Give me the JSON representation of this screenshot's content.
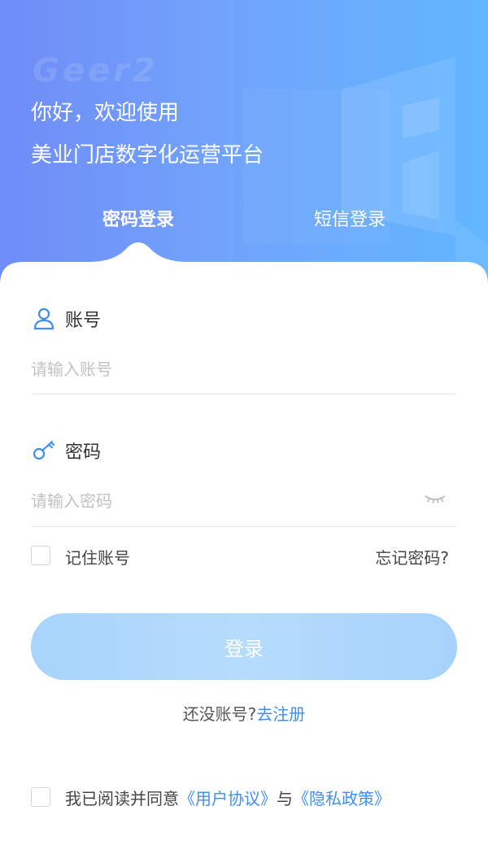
{
  "hero": {
    "watermark": "Geer2",
    "greeting_line1": "你好，欢迎使用",
    "greeting_line2": "美业门店数字化运营平台",
    "gradient_colors": [
      "#6f8cf7",
      "#61b6ff"
    ]
  },
  "tabs": [
    {
      "label": "密码登录",
      "active": true
    },
    {
      "label": "短信登录",
      "active": false
    }
  ],
  "account": {
    "label": "账号",
    "icon": "user-icon",
    "placeholder": "请输入账号",
    "value": ""
  },
  "password": {
    "label": "密码",
    "icon": "key-icon",
    "placeholder": "请输入密码",
    "value": "",
    "toggle_icon": "eye-closed-icon"
  },
  "remember": {
    "label": "记住账号",
    "checked": false
  },
  "forgot_label": "忘记密码?",
  "login_button": "登录",
  "register": {
    "prompt": "还没账号?",
    "link": "去注册"
  },
  "agreement": {
    "prefix": "我已阅读并同意",
    "user_agreement": "《用户协议》",
    "connector": "与",
    "privacy_policy": "《隐私政策》",
    "checked": false
  },
  "colors": {
    "accent": "#3e8ff0",
    "button": "#a8d4fb",
    "placeholder": "#c2c2c2"
  }
}
